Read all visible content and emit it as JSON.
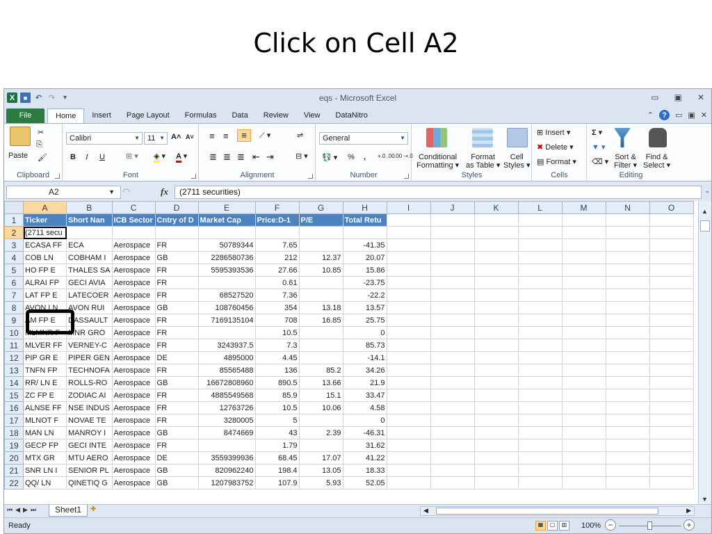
{
  "slide": {
    "title": "Click on Cell A2"
  },
  "window": {
    "title": "eqs - Microsoft Excel",
    "qat": {
      "app_icon": "X",
      "undo": "↶",
      "redo": "↷"
    },
    "controls": {
      "minimize": "▭",
      "restore": "▣",
      "close": "✕"
    }
  },
  "tabs": {
    "file": "File",
    "items": [
      "Home",
      "Insert",
      "Page Layout",
      "Formulas",
      "Data",
      "Review",
      "View",
      "DataNitro"
    ]
  },
  "ribbon": {
    "clipboard": {
      "paste": "Paste",
      "label": "Clipboard"
    },
    "font": {
      "name": "Calibri",
      "size": "11",
      "bold": "B",
      "italic": "I",
      "underline": "U",
      "grow": "A˄",
      "shrink": "A˅",
      "color_a": "A",
      "label": "Font"
    },
    "alignment": {
      "label": "Alignment"
    },
    "number": {
      "format": "General",
      "percent": "%",
      "comma": ",",
      "inc_dec": "+.0 .00",
      "dec_dec": ".00 →.0",
      "label": "Number"
    },
    "styles": {
      "conditional": [
        "Conditional",
        "Formatting ▾"
      ],
      "format_table": [
        "Format",
        "as Table ▾"
      ],
      "cell_styles": [
        "Cell",
        "Styles ▾"
      ],
      "label": "Styles"
    },
    "cells": {
      "insert": "Insert ▾",
      "delete": "Delete ▾",
      "format": "Format ▾",
      "label": "Cells"
    },
    "editing": {
      "sigma": "Σ ▾",
      "sort": [
        "Sort &",
        "Filter ▾"
      ],
      "find": [
        "Find &",
        "Select ▾"
      ],
      "label": "Editing"
    }
  },
  "formula_bar": {
    "name_box": "A2",
    "fx": "fx",
    "value": "(2711 securities)"
  },
  "sheet": {
    "columns": [
      "A",
      "B",
      "C",
      "D",
      "E",
      "F",
      "G",
      "H",
      "I",
      "J",
      "K",
      "L",
      "M",
      "N",
      "O"
    ],
    "header_row": [
      "Ticker",
      "Short Nan",
      "ICB Sector",
      "Cntry of D",
      "Market Cap",
      "Price:D-1",
      "P/E",
      "Total Retu"
    ],
    "row2": "(2711 secu",
    "rows": [
      [
        "3",
        "ECASA  FF",
        "ECA",
        "Aerospace",
        "FR",
        "50789344",
        "7.65",
        "",
        "-41.35"
      ],
      [
        "4",
        "COB   LN",
        "COBHAM I",
        "Aerospace",
        "GB",
        "2286580736",
        "212",
        "12.37",
        "20.07"
      ],
      [
        "5",
        "HO    FP E",
        "THALES SA",
        "Aerospace",
        "FR",
        "5595393536",
        "27.66",
        "10.85",
        "15.86"
      ],
      [
        "6",
        "ALRAI  FP",
        "GECI AVIA",
        "Aerospace",
        "FR",
        "",
        "0.61",
        "",
        "-23.75"
      ],
      [
        "7",
        "LAT   FP E",
        "LATECOER",
        "Aerospace",
        "FR",
        "68527520",
        "7.36",
        "",
        "-22.2"
      ],
      [
        "8",
        "AVON   LN",
        "AVON RUI",
        "Aerospace",
        "GB",
        "108760456",
        "354",
        "13.18",
        "13.57"
      ],
      [
        "9",
        "AM    FP E",
        "DASSAULT",
        "Aerospace",
        "FR",
        "7169135104",
        "708",
        "16.85",
        "25.75"
      ],
      [
        "10",
        "MLMNR  F",
        "MNR GRO",
        "Aerospace",
        "FR",
        "",
        "10.5",
        "",
        "0"
      ],
      [
        "11",
        "MLVER  FF",
        "VERNEY-C",
        "Aerospace",
        "FR",
        "3243937.5",
        "7.3",
        "",
        "85.73"
      ],
      [
        "12",
        "PIP   GR E",
        "PIPER GEN",
        "Aerospace",
        "DE",
        "4895000",
        "4.45",
        "",
        "-14.1"
      ],
      [
        "13",
        "TNFN  FP",
        "TECHNOFA",
        "Aerospace",
        "FR",
        "85565488",
        "136",
        "85.2",
        "34.26"
      ],
      [
        "14",
        "RR/   LN E",
        "ROLLS-RO",
        "Aerospace",
        "GB",
        "16672808960",
        "890.5",
        "13.66",
        "21.9"
      ],
      [
        "15",
        "ZC    FP E",
        "ZODIAC AI",
        "Aerospace",
        "FR",
        "4885549568",
        "85.9",
        "15.1",
        "33.47"
      ],
      [
        "16",
        "ALNSE  FF",
        "NSE INDUS",
        "Aerospace",
        "FR",
        "12763726",
        "10.5",
        "10.06",
        "4.58"
      ],
      [
        "17",
        "MLNOT  F",
        "NOVAE TE",
        "Aerospace",
        "FR",
        "3280005",
        "5",
        "",
        "0"
      ],
      [
        "18",
        "MAN   LN",
        "MANROY I",
        "Aerospace",
        "GB",
        "8474669",
        "43",
        "2.39",
        "-46.31"
      ],
      [
        "19",
        "GECP  FP",
        "GECI INTE",
        "Aerospace",
        "FR",
        "",
        "1.79",
        "",
        "31.62"
      ],
      [
        "20",
        "MTX   GR",
        "MTU AERO",
        "Aerospace",
        "DE",
        "3559399936",
        "68.45",
        "17.07",
        "41.22"
      ],
      [
        "21",
        "SNR   LN I",
        "SENIOR PL",
        "Aerospace",
        "GB",
        "820962240",
        "198.4",
        "13.05",
        "18.33"
      ],
      [
        "22",
        "QQ/   LN",
        "QINETIQ G",
        "Aerospace",
        "GB",
        "1207983752",
        "107.9",
        "5.93",
        "52.05"
      ]
    ],
    "tab": "Sheet1"
  },
  "status": {
    "text": "Ready",
    "zoom": "100%"
  },
  "colors": {
    "header_fill": "#4f81bd",
    "file_tab": "#2c7a3f",
    "selected_header": "#f9d99f"
  }
}
